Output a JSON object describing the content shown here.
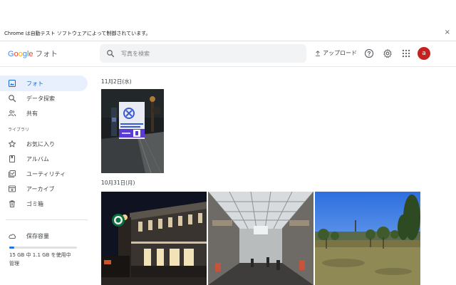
{
  "infobar": {
    "message": "Chrome は自動テスト ソフトウェアによって制御されています。",
    "close_symbol": "×"
  },
  "header": {
    "logo_letters": [
      "G",
      "o",
      "o",
      "g",
      "l",
      "e"
    ],
    "product_name": "フォト",
    "search_placeholder": "写真を検索",
    "upload_label": "アップロード",
    "avatar_letter": "a",
    "avatar_color": "#c5221f"
  },
  "sidebar": {
    "items": [
      {
        "label": "フォト",
        "icon": "photo-icon",
        "active": true
      },
      {
        "label": "データ探索",
        "icon": "search-icon",
        "active": false
      },
      {
        "label": "共有",
        "icon": "people-icon",
        "active": false
      }
    ],
    "library_label": "ライブラリ",
    "library_items": [
      {
        "label": "お気に入り",
        "icon": "star-icon"
      },
      {
        "label": "アルバム",
        "icon": "album-icon"
      },
      {
        "label": "ユーティリティ",
        "icon": "utility-icon"
      },
      {
        "label": "アーカイブ",
        "icon": "archive-icon"
      },
      {
        "label": "ゴミ箱",
        "icon": "trash-icon"
      }
    ],
    "storage": {
      "label": "保存容量",
      "usage_text": "15 GB 中 1.1 GB を使用中",
      "used_fraction": 0.073,
      "more_text": "管理"
    }
  },
  "main": {
    "groups": [
      {
        "date": "11月2日(水)",
        "photos": [
          "night-street-sign"
        ]
      },
      {
        "date": "10月31日(月)",
        "photos": [
          "night-building",
          "shopping-arcade",
          "park-blue-sky"
        ]
      }
    ]
  },
  "colors": {
    "accent": "#1a73e8",
    "active_bg": "#e8f0fe",
    "active_text": "#1967d2"
  }
}
